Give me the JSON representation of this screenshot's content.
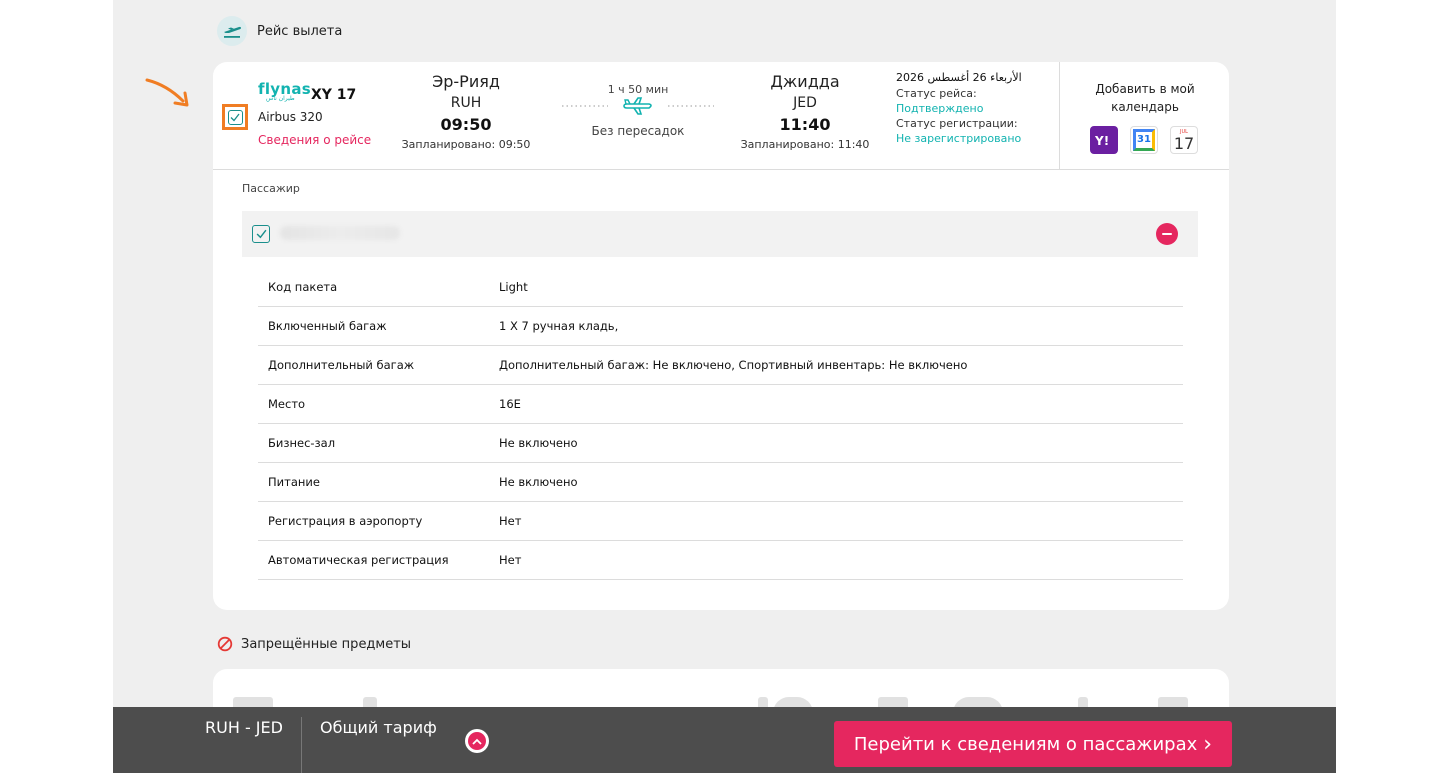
{
  "section": {
    "title": "Рейс вылета"
  },
  "flight": {
    "airline_logo": "flynas",
    "airline_logo_sub": "طيران ناس",
    "flight_number": "XY 17",
    "aircraft": "Airbus 320",
    "details_link": "Сведения о рейсе",
    "origin": {
      "city": "Эр-Рияд",
      "code": "RUH",
      "time": "09:50",
      "scheduled": "Запланировано: 09:50"
    },
    "duration": "1 ч 50 мин",
    "stops": "Без пересадок",
    "destination": {
      "city": "Джидда",
      "code": "JED",
      "time": "11:40",
      "scheduled": "Запланировано: 11:40"
    },
    "date": "الأربعاء 26 أغسطس 2026",
    "flight_status_label": "Статус рейса:",
    "flight_status_value": "Подтверждено",
    "checkin_status_label": "Статус регистрации:",
    "checkin_status_value": "Не зарегистрировано",
    "selected": true
  },
  "calendar": {
    "title": "Добавить в мой календарь",
    "icons": [
      "yahoo-calendar-icon",
      "google-calendar-icon",
      "apple-calendar-icon"
    ],
    "google_day": "31",
    "apple_month": "JUL",
    "apple_day": "17"
  },
  "passenger": {
    "label": "Пассажир",
    "selected": true
  },
  "details": [
    {
      "key": "Код пакета",
      "value": "Light"
    },
    {
      "key": "Включенный багаж",
      "value": "1 X 7 ручная кладь,"
    },
    {
      "key": "Дополнительный багаж",
      "value": "Дополнительный багаж: Не включено, Спортивный инвентарь: Не включено"
    },
    {
      "key": "Место",
      "value": "16E"
    },
    {
      "key": "Бизнес-зал",
      "value": "Не включено"
    },
    {
      "key": "Питание",
      "value": "Не включено"
    },
    {
      "key": "Регистрация в аэропорту",
      "value": "Нет"
    },
    {
      "key": "Автоматическая регистрация",
      "value": "Нет"
    }
  ],
  "prohibited": {
    "title": "Запрещённые предметы"
  },
  "bottom_bar": {
    "route": "RUH - JED",
    "fare": "Общий тариф",
    "cta": "Перейти к сведениям о пассажирах",
    "cta_arrow": "›"
  },
  "colors": {
    "accent": "#e5275f",
    "teal": "#12b3b0",
    "annotation": "#f07d23",
    "bottom_bar": "#4d4d4d"
  }
}
